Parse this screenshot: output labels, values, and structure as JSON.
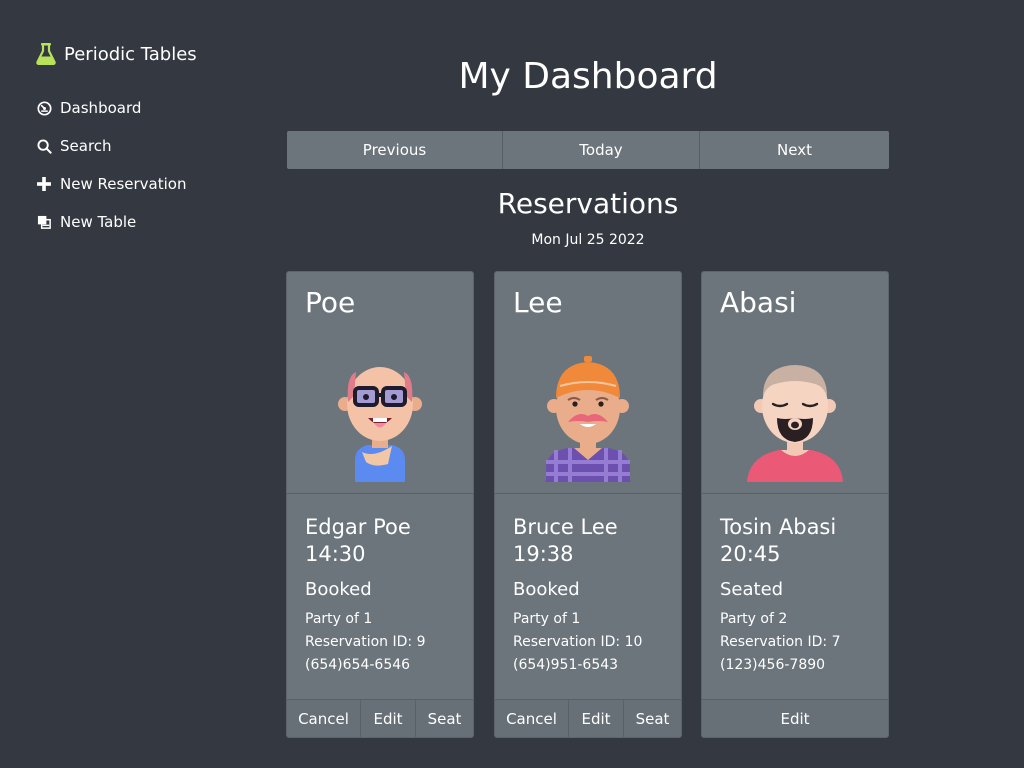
{
  "app": {
    "title": "Periodic Tables",
    "brand_color": "#b6e35a"
  },
  "sidebar": {
    "items": [
      {
        "label": "Dashboard",
        "icon": "dashboard-icon"
      },
      {
        "label": "Search",
        "icon": "search-icon"
      },
      {
        "label": "New Reservation",
        "icon": "plus-icon"
      },
      {
        "label": "New Table",
        "icon": "new-table-icon"
      }
    ]
  },
  "main": {
    "title": "My Dashboard",
    "date_nav": {
      "previous": "Previous",
      "today": "Today",
      "next": "Next"
    },
    "reservations_heading": "Reservations",
    "date": "Mon Jul 25 2022"
  },
  "reservations": [
    {
      "surname": "Poe",
      "full_name": "Edgar Poe",
      "time": "14:30",
      "status": "Booked",
      "party": "Party of 1",
      "reservation_id": "Reservation ID: 9",
      "phone": "(654)654-6546",
      "avatar": "bald-man-glasses-avatar",
      "actions": {
        "cancel": "Cancel",
        "edit": "Edit",
        "seat": "Seat"
      }
    },
    {
      "surname": "Lee",
      "full_name": "Bruce Lee",
      "time": "19:38",
      "status": "Booked",
      "party": "Party of 1",
      "reservation_id": "Reservation ID: 10",
      "phone": "(654)951-6543",
      "avatar": "man-orange-cap-mustache-avatar",
      "actions": {
        "cancel": "Cancel",
        "edit": "Edit",
        "seat": "Seat"
      }
    },
    {
      "surname": "Abasi",
      "full_name": "Tosin Abasi",
      "time": "20:45",
      "status": "Seated",
      "party": "Party of 2",
      "reservation_id": "Reservation ID: 7",
      "phone": "(123)456-7890",
      "avatar": "bearded-man-avatar",
      "actions": {
        "edit": "Edit"
      }
    }
  ]
}
